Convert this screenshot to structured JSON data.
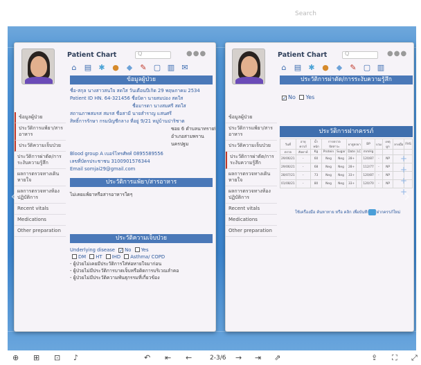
{
  "viewer": {
    "search_placeholder": "Search",
    "page_indicator": "2-3/6"
  },
  "left_page": {
    "chart_title": "Patient Chart",
    "search_box": "Q",
    "section_patient": "ข้อมูลผู้ป่วย",
    "name_line": "ชื่อ-สกุล นางสาวสนใจ สดใส วันเดือนปีเกิด 29 พฤษภาคม 2534",
    "pid_line": "Patient ID HN. 64-321456 ชื่อบิดา นายสมปอง สดใส",
    "mother_line": "ชื่อมารดา นางสมศรี สดใส",
    "marital_line": "สถานภาพสมรส สมรส ชื่อสามี นายสำราญ แสนศรี",
    "rights_line": "สิทธิ์การรักษา กรมบัญชีกลาง ที่อยู่ 9/21 หมู่บ้านปาริชาต",
    "addr2": "ซอย 6 ตำบลนาทรายทิก",
    "addr3": "อำเภอสามพราน",
    "addr4": "นครปฐม",
    "blood_line": "Blood group A เบอร์โทรศัพท์ 0895589556",
    "idcard_line": "เลขที่บัตรประชาชน 3100901576344",
    "email_line": "Email somjai29@gmail.com",
    "section_allergy": "ประวัติการแพ้ยา/สารอาหาร",
    "allergy_text": "ไม่เคยแพ้ยาหรือสารอาหารใดๆ",
    "section_illness": "ประวัติความเจ็บป่วย",
    "underlying_label": "Underlying disease",
    "no_label": "No",
    "yes_label": "Yes",
    "dm": "DM",
    "ht": "HT",
    "ihd": "IHD",
    "asthma": "Asthma/ COPD",
    "hist1": "- ผู้ป่วยไม่เคยมีประวัติการใส่ท่อหายใจมาก่อน",
    "hist2": "- ผู้ป่วยไม่มีประวัติการบาดเจ็บหรือติดการบริเวณลำคอ",
    "hist3": "- ผู้ป่วยไม่มีประวัติความพันธุกรรมที่เกี่ยวข้อง"
  },
  "right_page": {
    "chart_title": "Patient Chart",
    "search_box": "Q",
    "section_surgery": "ประวัติการผ่าตัด/การระงับความรู้สึก",
    "no_label": "No",
    "yes_label": "Yes",
    "section_pregnancy": "ประวัติการฝากครรภ์",
    "table_headers": [
      "วันที่",
      "อายุครรภ์",
      "น้ำหนัก",
      "การตรวจปัสสาวะ",
      "ยาสูตรยา",
      "BP",
      "บวม",
      "เหตุผูก",
      "ลายมือ",
      "FHS"
    ],
    "table_subheaders": [
      "ตรวจ",
      "สัปดาห์",
      "Kg",
      "Protein",
      "Sugar",
      "Date",
      "LC",
      "mmHg"
    ],
    "rows": [
      [
        "29/06/21",
        "-",
        "60",
        "Neg",
        "Neg",
        "28+",
        "",
        "120/87",
        "-",
        "NP"
      ],
      [
        "29/06/21",
        "-",
        "68",
        "Neg",
        "Neg",
        "28+",
        "",
        "112/77",
        "-",
        "NP"
      ],
      [
        "28/07/21",
        "-",
        "73",
        "Neg",
        "Neg",
        "33+",
        "",
        "120/87",
        "-",
        "NP"
      ],
      [
        "01/08/21",
        "-",
        "80",
        "Neg",
        "Neg",
        "33+",
        "",
        "120/70",
        "-",
        "NP"
      ]
    ],
    "footer_note": "ใช้เครื่องมือ ค้นหาทาย หรือ คลิก เพื่อบันทึกการฝากครรภ์ใหม่"
  },
  "sidebar": [
    "ข้อมูลผู้ป่วย",
    "ประวัติการแพ้ยา/สารอาหาร",
    "ประวัติความเจ็บป่วย",
    "ประวัติการผ่าตัด/การระงับความรู้สึก",
    "ผลการตรวจทางเดินหายใจ",
    "ผลการตรวจทางห้องปฏิบัติการ",
    "Recent vitals",
    "Medications",
    "Other preparation"
  ]
}
